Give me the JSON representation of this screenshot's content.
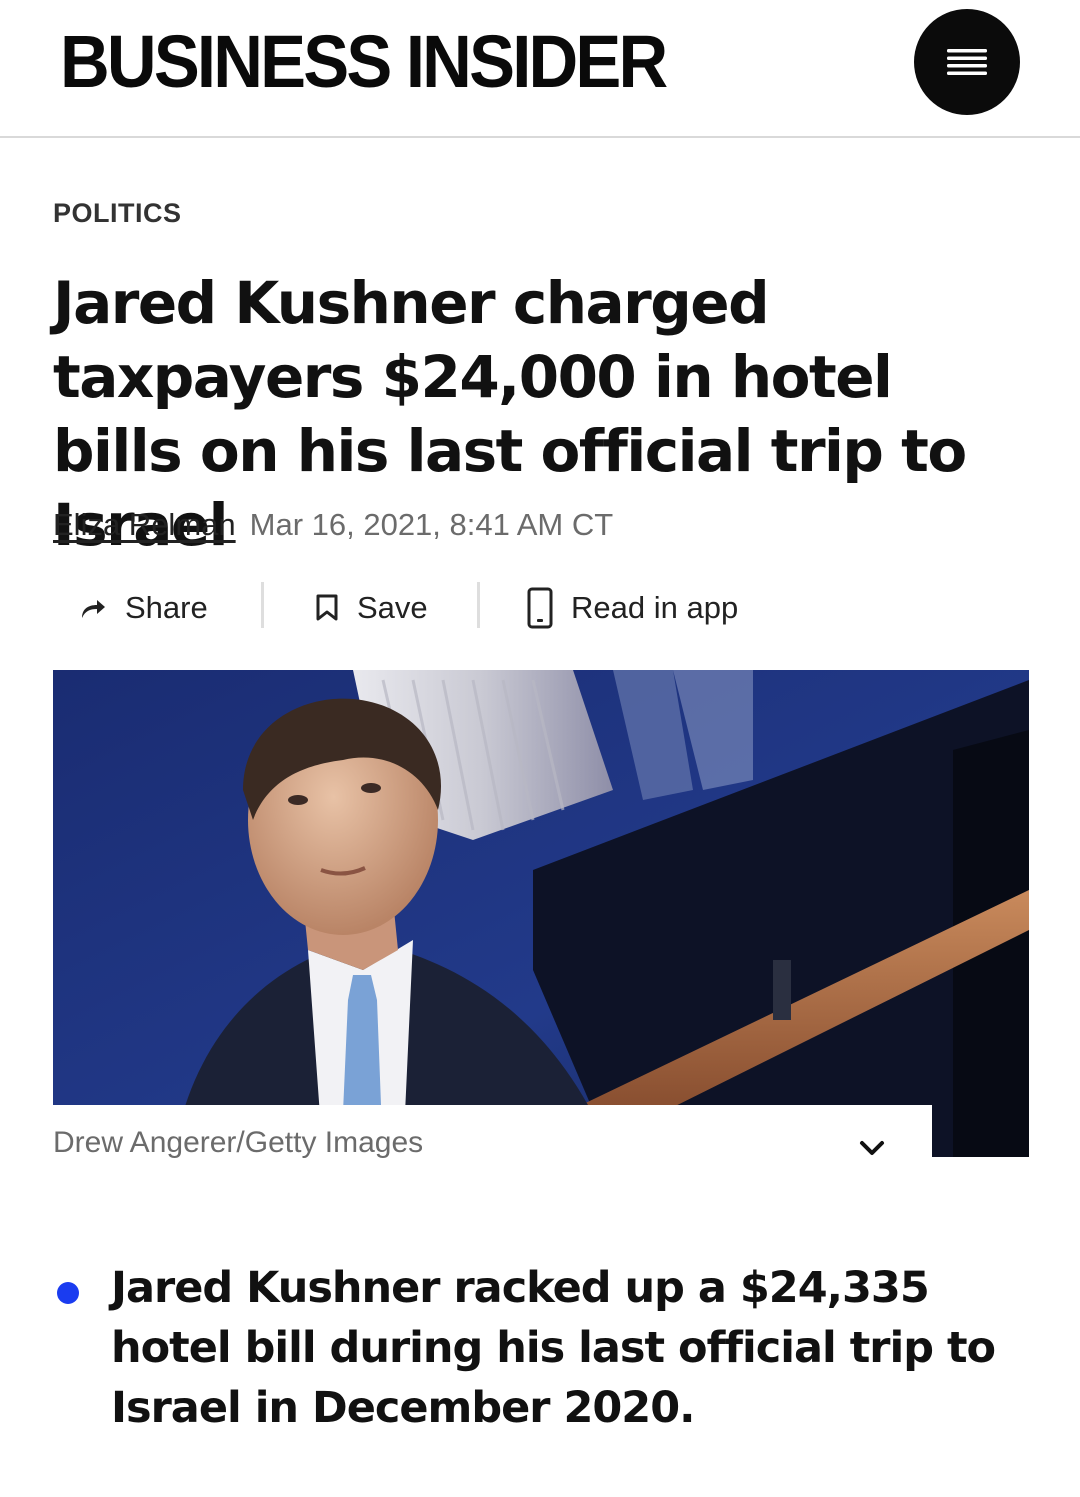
{
  "header": {
    "logo": "BUSINESS INSIDER",
    "menu_icon": "hamburger-menu-icon"
  },
  "article": {
    "category": "POLITICS",
    "headline": "Jared Kushner charged taxpayers $24,000 in hotel bills on his last official trip to Israel",
    "author": "Eliza Relman",
    "date": "Mar 16, 2021, 8:41 AM CT"
  },
  "actions": [
    {
      "label": "Share",
      "icon": "share-arrow-icon"
    },
    {
      "label": "Save",
      "icon": "bookmark-icon"
    },
    {
      "label": "Read in app",
      "icon": "phone-icon"
    }
  ],
  "photo": {
    "caption": "Drew Angerer/Getty Images",
    "toggle_icon": "chevron-down-icon"
  },
  "bullets": [
    "Jared Kushner racked up a $24,335 hotel bill during his last official trip to Israel in December 2020."
  ],
  "colors": {
    "bullet": "#1a3cf0",
    "text": "#111111",
    "meta": "#6b6b6b"
  }
}
